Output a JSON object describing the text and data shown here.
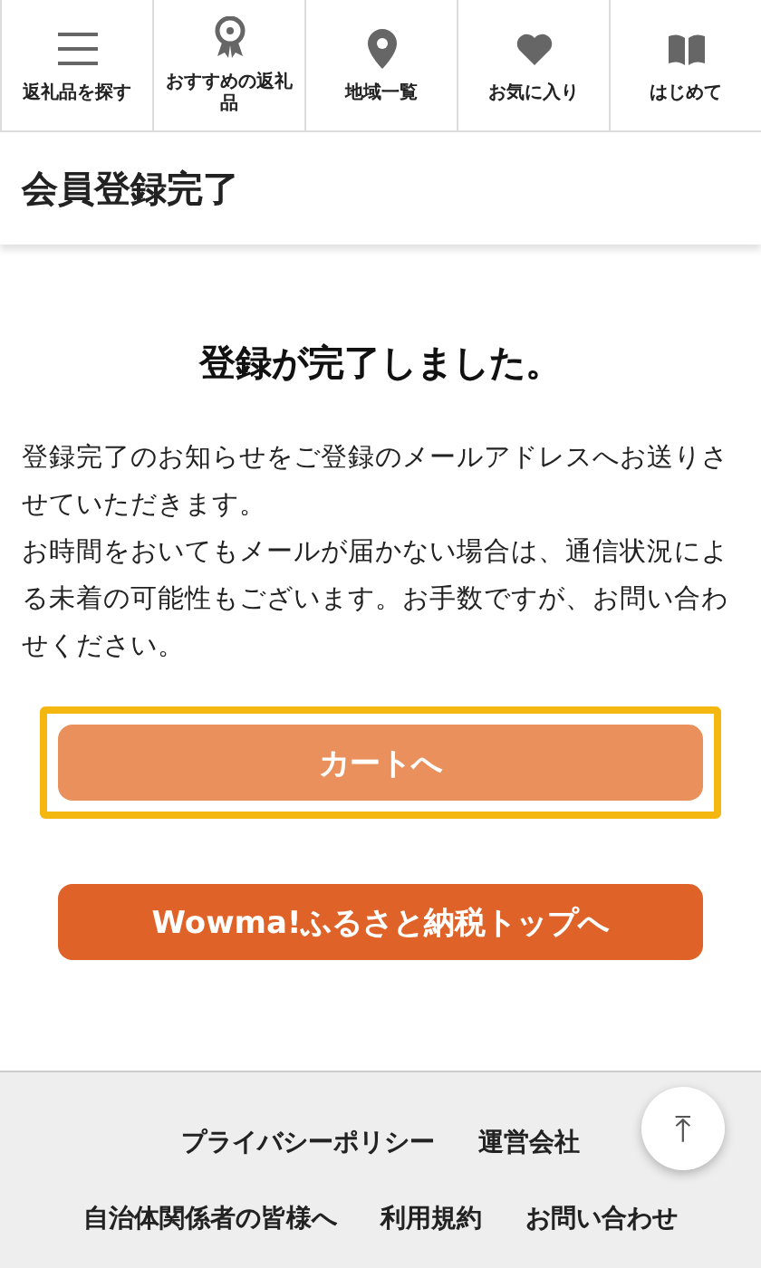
{
  "nav": [
    {
      "label": "返礼品を探す"
    },
    {
      "label": "おすすめの返礼品"
    },
    {
      "label": "地域一覧"
    },
    {
      "label": "お気に入り"
    },
    {
      "label": "はじめて"
    }
  ],
  "page_title": "会員登録完了",
  "heading": "登録が完了しました。",
  "paragraphs": [
    "登録完了のお知らせをご登録のメールアドレスへお送りさせていただきます。",
    "お時間をおいてもメールが届かない場合は、通信状況による未着の可能性もございます。お手数ですが、お問い合わせください。"
  ],
  "buttons": [
    {
      "label": "カートへ",
      "kind": "light",
      "highlighted": true
    },
    {
      "label": "Wowma!ふるさと納税トップへ",
      "kind": "dark",
      "highlighted": false
    }
  ],
  "footer_links": [
    [
      "プライバシーポリシー",
      "運営会社"
    ],
    [
      "自治体関係者の皆様へ",
      "利用規約",
      "お問い合わせ"
    ]
  ],
  "back_to_top": "⤒"
}
